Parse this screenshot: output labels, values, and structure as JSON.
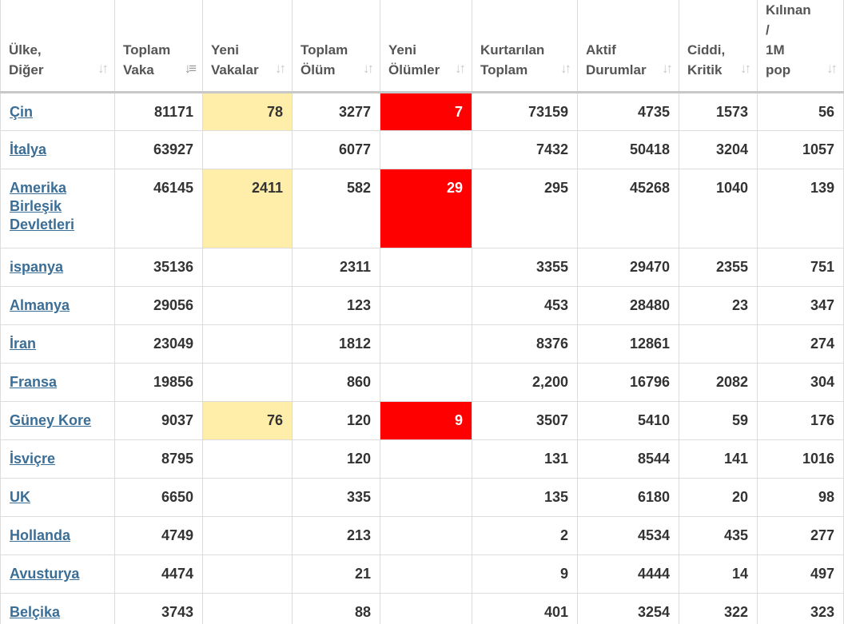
{
  "colors": {
    "new_cases_highlight": "#ffeeaa",
    "new_deaths_highlight": "#ff0000",
    "link": "#3b6e96",
    "header_text": "#555555",
    "cell_text": "#333333"
  },
  "columns": [
    {
      "line1": "Ülke,",
      "line2": "Diğer",
      "sort_icon": "sort-icon",
      "active": false
    },
    {
      "line1": "Toplam",
      "line2": "Vaka",
      "sort_icon": "sort-desc-icon",
      "active": true
    },
    {
      "line1": "Yeni",
      "line2": "Vakalar",
      "sort_icon": "sort-icon",
      "active": false
    },
    {
      "line1": "Toplam",
      "line2": "Ölüm",
      "sort_icon": "sort-icon",
      "active": false
    },
    {
      "line1": "Yeni",
      "line2": "Ölümler",
      "sort_icon": "sort-icon",
      "active": false
    },
    {
      "line1": "Kurtarılan",
      "line2": "Toplam",
      "sort_icon": "sort-icon",
      "active": false
    },
    {
      "line1": "Aktif",
      "line2": "Durumlar",
      "sort_icon": "sort-icon",
      "active": false
    },
    {
      "line1": "Ciddi,",
      "line2": "Kritik",
      "sort_icon": "sort-icon",
      "active": false
    },
    {
      "line0": "Kılınan",
      "line_slash": "/",
      "line1": "1M",
      "line2": "pop",
      "sort_icon": "sort-icon",
      "active": false
    }
  ],
  "rows": [
    {
      "country": "Çin",
      "total_cases": "81171",
      "new_cases": "78",
      "total_deaths": "3277",
      "new_deaths": "7",
      "total_recovered": "73159",
      "active_cases": "4735",
      "serious_critical": "1573",
      "per_1m": "56"
    },
    {
      "country": "İtalya",
      "total_cases": "63927",
      "new_cases": "",
      "total_deaths": "6077",
      "new_deaths": "",
      "total_recovered": "7432",
      "active_cases": "50418",
      "serious_critical": "3204",
      "per_1m": "1057"
    },
    {
      "country_lines": [
        "Amerika",
        "Birleşik",
        "Devletleri"
      ],
      "total_cases": "46145",
      "new_cases": "2411",
      "total_deaths": "582",
      "new_deaths": "29",
      "total_recovered": "295",
      "active_cases": "45268",
      "serious_critical": "1040",
      "per_1m": "139"
    },
    {
      "country": "ispanya",
      "total_cases": "35136",
      "new_cases": "",
      "total_deaths": "2311",
      "new_deaths": "",
      "total_recovered": "3355",
      "active_cases": "29470",
      "serious_critical": "2355",
      "per_1m": "751"
    },
    {
      "country": "Almanya",
      "total_cases": "29056",
      "new_cases": "",
      "total_deaths": "123",
      "new_deaths": "",
      "total_recovered": "453",
      "active_cases": "28480",
      "serious_critical": "23",
      "per_1m": "347"
    },
    {
      "country": "İran",
      "total_cases": "23049",
      "new_cases": "",
      "total_deaths": "1812",
      "new_deaths": "",
      "total_recovered": "8376",
      "active_cases": "12861",
      "serious_critical": "",
      "per_1m": "274"
    },
    {
      "country": "Fransa",
      "total_cases": "19856",
      "new_cases": "",
      "total_deaths": "860",
      "new_deaths": "",
      "total_recovered": "2,200",
      "active_cases": "16796",
      "serious_critical": "2082",
      "per_1m": "304"
    },
    {
      "country": "Güney Kore",
      "total_cases": "9037",
      "new_cases": "76",
      "total_deaths": "120",
      "new_deaths": "9",
      "total_recovered": "3507",
      "active_cases": "5410",
      "serious_critical": "59",
      "per_1m": "176"
    },
    {
      "country": "İsviçre",
      "total_cases": "8795",
      "new_cases": "",
      "total_deaths": "120",
      "new_deaths": "",
      "total_recovered": "131",
      "active_cases": "8544",
      "serious_critical": "141",
      "per_1m": "1016"
    },
    {
      "country": "UK",
      "total_cases": "6650",
      "new_cases": "",
      "total_deaths": "335",
      "new_deaths": "",
      "total_recovered": "135",
      "active_cases": "6180",
      "serious_critical": "20",
      "per_1m": "98"
    },
    {
      "country": "Hollanda",
      "total_cases": "4749",
      "new_cases": "",
      "total_deaths": "213",
      "new_deaths": "",
      "total_recovered": "2",
      "active_cases": "4534",
      "serious_critical": "435",
      "per_1m": "277"
    },
    {
      "country": "Avusturya",
      "total_cases": "4474",
      "new_cases": "",
      "total_deaths": "21",
      "new_deaths": "",
      "total_recovered": "9",
      "active_cases": "4444",
      "serious_critical": "14",
      "per_1m": "497"
    },
    {
      "country": "Belçika",
      "total_cases": "3743",
      "new_cases": "",
      "total_deaths": "88",
      "new_deaths": "",
      "total_recovered": "401",
      "active_cases": "3254",
      "serious_critical": "322",
      "per_1m": "323"
    }
  ]
}
